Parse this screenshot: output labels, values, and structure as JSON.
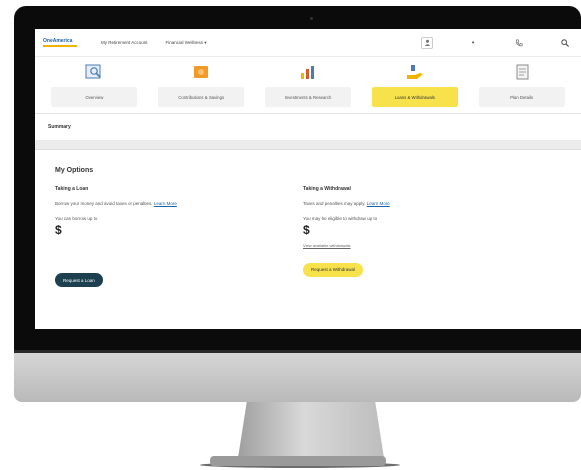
{
  "header": {
    "brand": "OneAmerica",
    "links": [
      "My Retirement Account",
      "Financial Wellness"
    ],
    "icons": [
      "user-icon",
      "dot-icon",
      "phone-icon",
      "search-icon"
    ]
  },
  "tabs": [
    {
      "label": "Overview",
      "icon": "magnify-chart-icon",
      "color": "#4a7bb8"
    },
    {
      "label": "Contributions & Savings",
      "icon": "coins-icon",
      "color": "#f09a2a"
    },
    {
      "label": "Investments & Research",
      "icon": "bar-chart-icon",
      "color": "#d9572b"
    },
    {
      "label": "Loans & Withdrawals",
      "icon": "hand-coins-icon",
      "color": "#f0b400",
      "active": true
    },
    {
      "label": "Plan Details",
      "icon": "document-icon",
      "color": "#8a8a8a"
    }
  ],
  "subnav": "Summary",
  "main": {
    "title": "My Options",
    "loan": {
      "heading": "Taking a Loan",
      "desc": "Borrow your money and avoid taxes or penalties.",
      "learn_more": "Learn More",
      "sub": "You can borrow up to",
      "amount": "$",
      "button": "Request a Loan"
    },
    "withdrawal": {
      "heading": "Taking a Withdrawal",
      "desc": "Taxes and penalties may apply.",
      "learn_more": "Learn More",
      "sub": "You may be eligible to withdraw up to",
      "amount": "$",
      "link": "View available withdrawals",
      "button": "Request a Withdrawal"
    }
  },
  "colors": {
    "accent_yellow": "#f7e24c",
    "dark_button": "#1d4050",
    "brand_blue": "#1c63a8"
  }
}
